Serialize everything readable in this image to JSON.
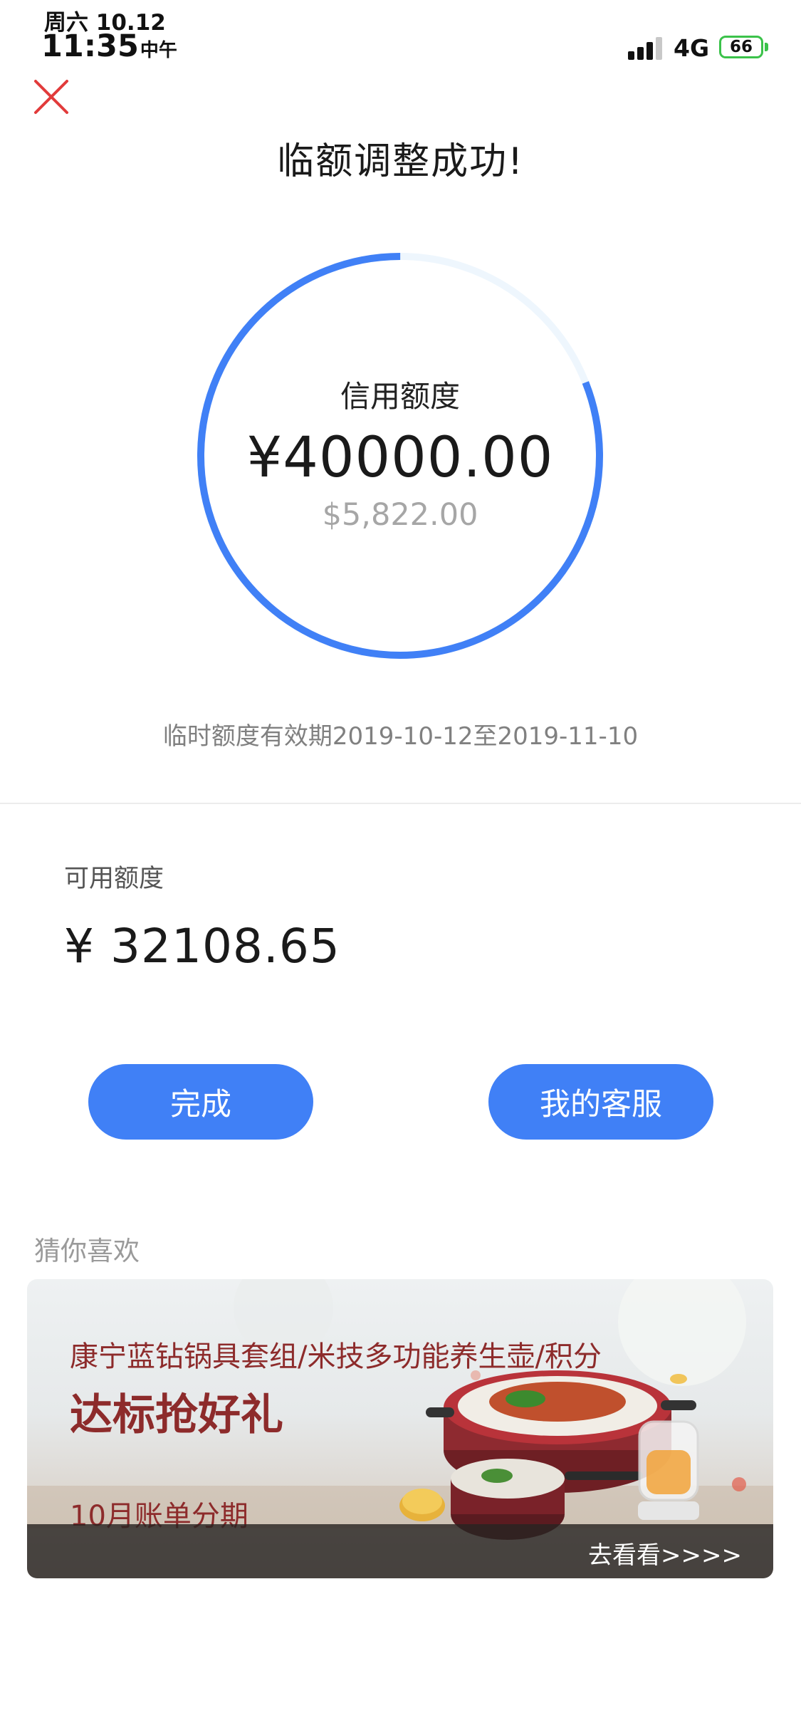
{
  "status_bar": {
    "date": "周六 10.12",
    "time": "11:35",
    "ampm": "中午",
    "network": "4G",
    "battery": "66"
  },
  "header": {
    "title": "临额调整成功!"
  },
  "credit": {
    "label": "信用额度",
    "amount": "¥40000.00",
    "sub_amount": "$5,822.00",
    "ring_progress": 0.81,
    "accent_color": "#4080f6",
    "track_color": "#eef6fd"
  },
  "validity_text": "临时额度有效期2019-10-12至2019-11-10",
  "available": {
    "label": "可用额度",
    "amount": "¥ 32108.65"
  },
  "buttons": {
    "done": "完成",
    "service": "我的客服"
  },
  "recommend": {
    "title": "猜你喜欢",
    "banner": {
      "line1": "康宁蓝钻锅具套组/米技多功能养生壶/积分",
      "line2": "达标抢好礼",
      "line3": "10月账单分期",
      "cta": "去看看>>>>"
    }
  }
}
